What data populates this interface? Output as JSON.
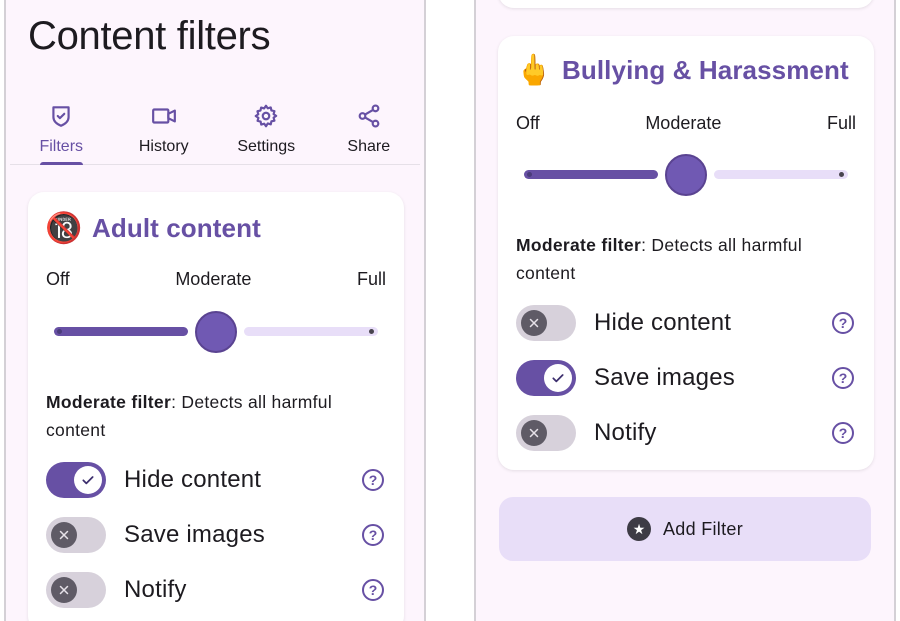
{
  "left_screen": {
    "title": "Content filters",
    "tabs": [
      {
        "label": "Filters",
        "icon": "shield-check-icon",
        "active": true
      },
      {
        "label": "History",
        "icon": "video-camera-icon",
        "active": false
      },
      {
        "label": "Settings",
        "icon": "gear-icon",
        "active": false
      },
      {
        "label": "Share",
        "icon": "share-icon",
        "active": false
      }
    ],
    "card": {
      "emoji": "🔞",
      "title": "Adult content",
      "slider": {
        "min_label": "Off",
        "mid_label": "Moderate",
        "max_label": "Full",
        "value": 0.5
      },
      "desc_bold": "Moderate filter",
      "desc_text": ": Detects all harmful content",
      "options": [
        {
          "label": "Hide content",
          "on": true
        },
        {
          "label": "Save images",
          "on": false
        },
        {
          "label": "Notify",
          "on": false
        }
      ],
      "help_glyph": "?"
    }
  },
  "right_screen": {
    "card": {
      "emoji": "🖕",
      "title": "Bullying & Harassment",
      "slider": {
        "min_label": "Off",
        "mid_label": "Moderate",
        "max_label": "Full",
        "value": 0.5
      },
      "desc_bold": "Moderate filter",
      "desc_text": ": Detects all harmful content",
      "options": [
        {
          "label": "Hide content",
          "on": false
        },
        {
          "label": "Save images",
          "on": true
        },
        {
          "label": "Notify",
          "on": false
        }
      ],
      "help_glyph": "?"
    },
    "add_filter_label": "Add Filter"
  },
  "colors": {
    "accent": "#6750a4",
    "track_inactive": "#e8def8",
    "background": "#fdf5fd"
  }
}
